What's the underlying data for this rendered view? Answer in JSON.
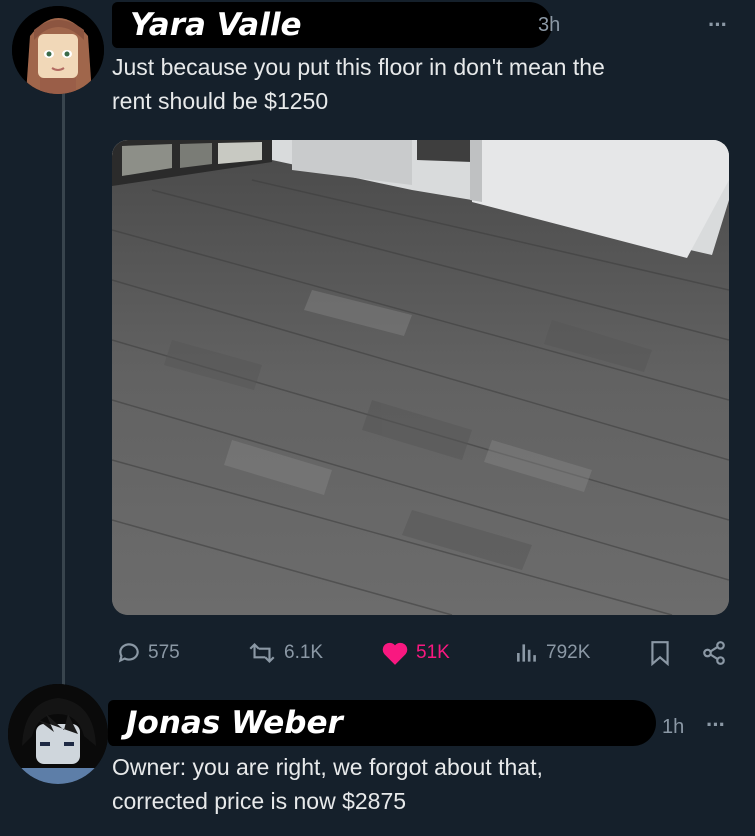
{
  "post": {
    "author": "Yara Valle",
    "time": "3h",
    "text_line1": "Just because you put this floor in don't mean the",
    "text_line2": "rent should be $1250",
    "more": "···",
    "stats": {
      "replies": "575",
      "reposts": "6.1K",
      "likes": "51K",
      "views": "792K"
    }
  },
  "reply": {
    "author": "Jonas Weber",
    "time": "1h",
    "text_line1": "Owner: you are right, we forgot about that,",
    "text_line2": "corrected price is now $2875",
    "more": "···"
  },
  "colors": {
    "background": "#15202b",
    "text": "#e7e9ea",
    "muted": "#8b98a5",
    "like": "#f91880",
    "thread": "#38444d"
  },
  "icons": [
    "reply-icon",
    "repost-icon",
    "like-icon",
    "views-icon",
    "bookmark-icon",
    "share-icon"
  ]
}
